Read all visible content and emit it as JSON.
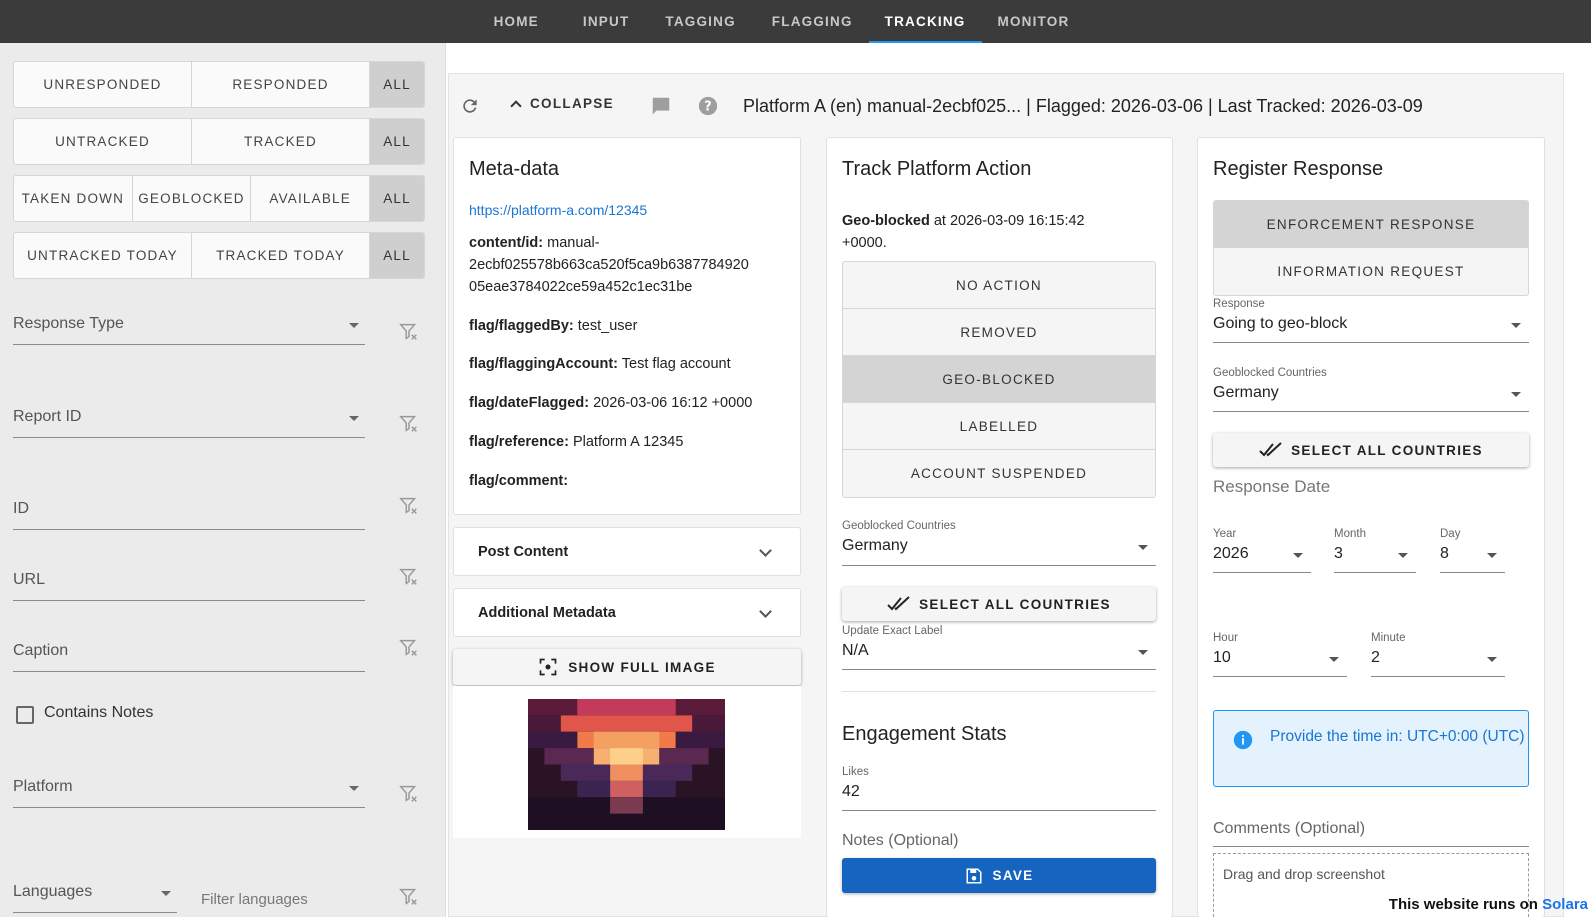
{
  "nav": {
    "tabs": [
      "HOME",
      "INPUT",
      "TAGGING",
      "FLAGGING",
      "TRACKING",
      "MONITOR"
    ],
    "active": "TRACKING",
    "accent": "#2196f3"
  },
  "sidebar": {
    "groups": [
      [
        "UNRESPONDED",
        "RESPONDED",
        "ALL"
      ],
      [
        "UNTRACKED",
        "TRACKED",
        "ALL"
      ],
      [
        "TAKEN DOWN",
        "GEOBLOCKED",
        "AVAILABLE",
        "ALL"
      ],
      [
        "UNTRACKED TODAY",
        "TRACKED TODAY",
        "ALL"
      ]
    ],
    "fields": {
      "response_type": "Response Type",
      "report_id": "Report ID",
      "id": "ID",
      "url": "URL",
      "caption": "Caption",
      "platform": "Platform",
      "languages": "Languages",
      "filter_languages": "Filter languages"
    },
    "contains_notes": "Contains Notes"
  },
  "toolbar": {
    "collapse": "COLLAPSE",
    "title": "Platform A (en) manual-2ecbf025... | Flagged: 2026-03-06 | Last Tracked: 2026-03-09"
  },
  "metadata": {
    "heading": "Meta-data",
    "link": "https://platform-a.com/12345",
    "content_id_key": "content/id:",
    "content_id_val_1": "manual-",
    "content_id_val_2": "2ecbf025578b663ca520f5ca9b6387784920",
    "content_id_val_3": "05eae3784022ce59a452c1ec31be",
    "flagged_by_key": "flag/flaggedBy:",
    "flagged_by_val": "test_user",
    "flagging_account_key": "flag/flaggingAccount:",
    "flagging_account_val": "Test flag account",
    "date_flagged_key": "flag/dateFlagged:",
    "date_flagged_val": "2026-03-06 16:12 +0000",
    "reference_key": "flag/reference:",
    "reference_val": "Platform A 12345",
    "comment_key": "flag/comment:",
    "post_content": "Post Content",
    "additional_metadata": "Additional Metadata",
    "show_full_image": "SHOW FULL IMAGE"
  },
  "track": {
    "heading": "Track Platform Action",
    "status_bold": "Geo-blocked",
    "status_rest_1": "at 2026-03-09 16:15:42",
    "status_rest_2": "+0000.",
    "actions": [
      "NO ACTION",
      "REMOVED",
      "GEO-BLOCKED",
      "LABELLED",
      "ACCOUNT SUSPENDED"
    ],
    "selected_action": "GEO-BLOCKED",
    "geo_label": "Geoblocked Countries",
    "geo_value": "Germany",
    "select_all": "SELECT ALL COUNTRIES",
    "exact_label": "Update Exact Label",
    "exact_value": "N/A",
    "engagement_heading": "Engagement Stats",
    "likes_label": "Likes",
    "likes_value": "42",
    "notes_label": "Notes (Optional)",
    "save": "SAVE",
    "save_color": "#1565c0"
  },
  "register": {
    "heading": "Register Response",
    "types": [
      "ENFORCEMENT RESPONSE",
      "INFORMATION REQUEST"
    ],
    "selected_type": "ENFORCEMENT RESPONSE",
    "response_label": "Response",
    "response_value": "Going to geo-block",
    "geo_label": "Geoblocked Countries",
    "geo_value": "Germany",
    "select_all": "SELECT ALL COUNTRIES",
    "date_heading": "Response Date",
    "year_label": "Year",
    "year_value": "2026",
    "month_label": "Month",
    "month_value": "3",
    "day_label": "Day",
    "day_value": "8",
    "hour_label": "Hour",
    "hour_value": "10",
    "minute_label": "Minute",
    "minute_value": "2",
    "info": "Provide the time in: UTC+0:00 (UTC)",
    "comments_label": "Comments (Optional)",
    "drop_label": "Drag and drop screenshot"
  },
  "footer": {
    "text": "This website runs on",
    "brand": "Solara"
  }
}
